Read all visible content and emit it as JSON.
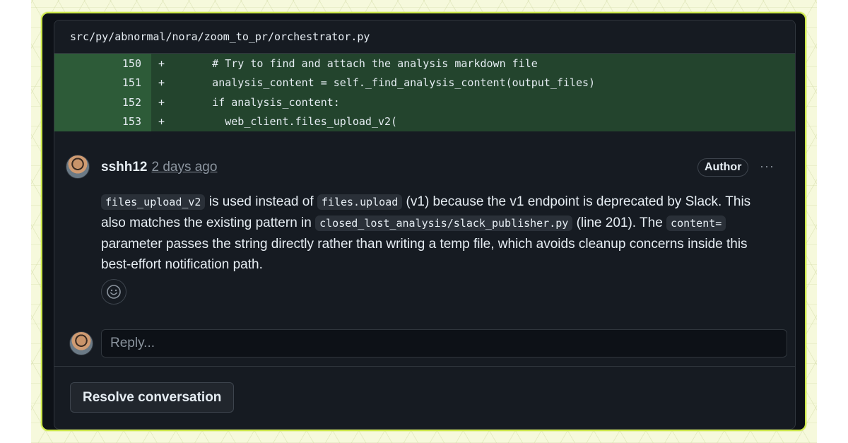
{
  "file": {
    "path": "src/py/abnormal/nora/zoom_to_pr/orchestrator.py"
  },
  "diff": {
    "lines": [
      {
        "num": "150",
        "sign": "+",
        "code": "      # Try to find and attach the analysis markdown file"
      },
      {
        "num": "151",
        "sign": "+",
        "code": "      analysis_content = self._find_analysis_content(output_files)"
      },
      {
        "num": "152",
        "sign": "+",
        "code": "      if analysis_content:"
      },
      {
        "num": "153",
        "sign": "+",
        "code": "        web_client.files_upload_v2("
      }
    ]
  },
  "comment": {
    "author": "sshh12",
    "timestamp": "2 days ago",
    "badge": "Author",
    "menu": "···",
    "body": {
      "code1": "files_upload_v2",
      "t1": " is used instead of ",
      "code2": "files.upload",
      "t2": " (v1) because the v1 endpoint is deprecated by Slack. This also matches the existing pattern in ",
      "code3": "closed_lost_analysis/slack_publisher.py",
      "t3": " (line 201). The ",
      "code4": "content=",
      "t4": " parameter passes the string directly rather than writing a temp file, which avoids cleanup concerns inside this best-effort notification path."
    }
  },
  "reply": {
    "placeholder": "Reply..."
  },
  "actions": {
    "resolve": "Resolve conversation"
  },
  "colors": {
    "frame": "#cde84a",
    "background": "#0d1117",
    "diff_add": "#23442d"
  }
}
